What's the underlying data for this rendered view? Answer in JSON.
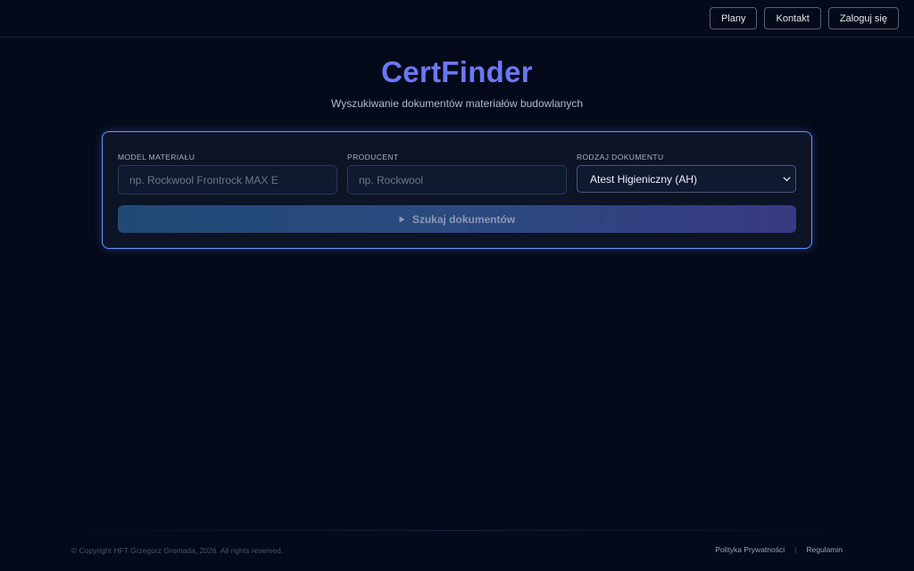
{
  "nav": {
    "plans_label": "Plany",
    "contact_label": "Kontakt",
    "login_label": "Zaloguj się"
  },
  "hero": {
    "brand": "CertFinder",
    "tagline": "Wyszukiwanie dokumentów materiałów budowlanych"
  },
  "search": {
    "model": {
      "label": "MODEL MATERIAŁU",
      "placeholder": "np. Rockwool Frontrock MAX E",
      "value": ""
    },
    "producer": {
      "label": "PRODUCENT",
      "placeholder": "np. Rockwool",
      "value": ""
    },
    "doc_type": {
      "label": "RODZAJ DOKUMENTU",
      "selected": "Atest Higieniczny (AH)",
      "icon": "chevron-down-icon"
    },
    "submit_label": "Szukaj dokumentów",
    "submit_icon": "play-icon"
  },
  "footer": {
    "copyright": "© Copyright HFT Grzegorz Gromada, 2026. All rights reserved.",
    "privacy_label": "Polityka Prywatności",
    "separator": "|",
    "terms_label": "Regulamin"
  },
  "colors": {
    "background": "#050a1a",
    "brand": "#6b78f5",
    "card_border": "#5a96f0",
    "button_gradient_start": "#204a75",
    "button_gradient_end": "#393a82"
  }
}
